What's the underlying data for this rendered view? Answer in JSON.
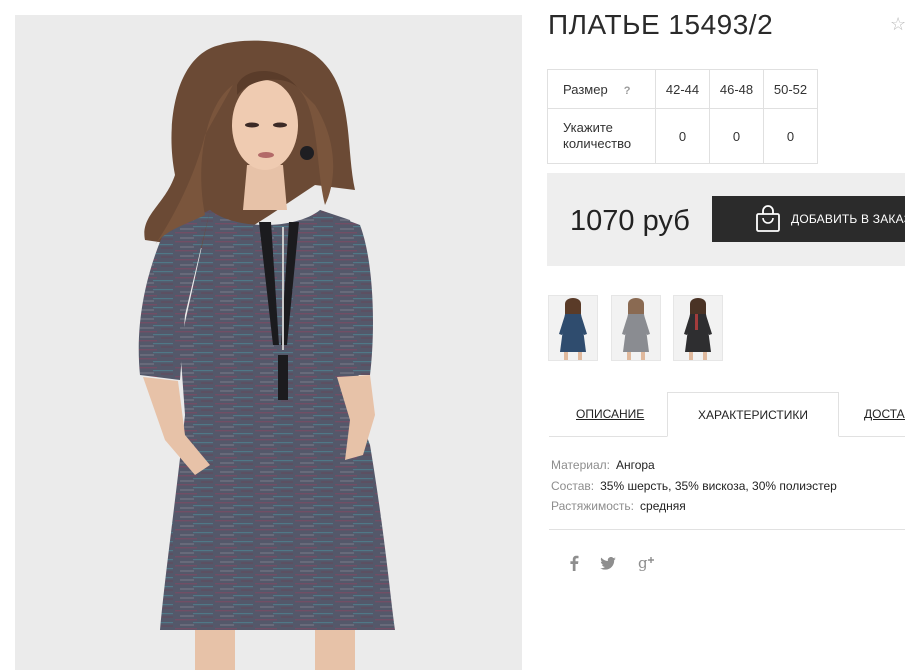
{
  "product": {
    "title": "ПЛАТЬЕ 15493/2"
  },
  "icons": {
    "favorite": "star-outline-icon",
    "help": "question-mark-icon",
    "cart": "shopping-bag-icon",
    "social": [
      "facebook-icon",
      "twitter-icon",
      "google-plus-icon"
    ]
  },
  "sizes": {
    "header_label": "Размер",
    "help_glyph": "?",
    "quantity_label_line1": "Укажите",
    "quantity_label_line2": "количество",
    "columns": [
      {
        "size": "42-44",
        "qty": "0"
      },
      {
        "size": "46-48",
        "qty": "0"
      },
      {
        "size": "50-52",
        "qty": "0"
      }
    ]
  },
  "price": {
    "value": "1070 руб",
    "order_button": "ДОБАВИТЬ В ЗАКАЗ"
  },
  "tabs": {
    "description": "ОПИСАНИЕ",
    "characteristics": "ХАРАКТЕРИСТИКИ",
    "delivery": "ДОСТАВКА"
  },
  "characteristics": [
    {
      "key": "Материал:",
      "value": "Ангора"
    },
    {
      "key": "Состав:",
      "value": "35% шерсть, 35% вискоза, 30% полиэстер"
    },
    {
      "key": "Растяжимость:",
      "value": "средняя"
    }
  ],
  "colors": {
    "button_bg": "#2b2b2b",
    "price_bg": "#eeeeee",
    "photo_bg": "#ebebeb",
    "dress_main": "#55596a",
    "thumb_dress_colors": [
      "#2f4c6e",
      "#8a8c91",
      "#2e2e30"
    ]
  }
}
